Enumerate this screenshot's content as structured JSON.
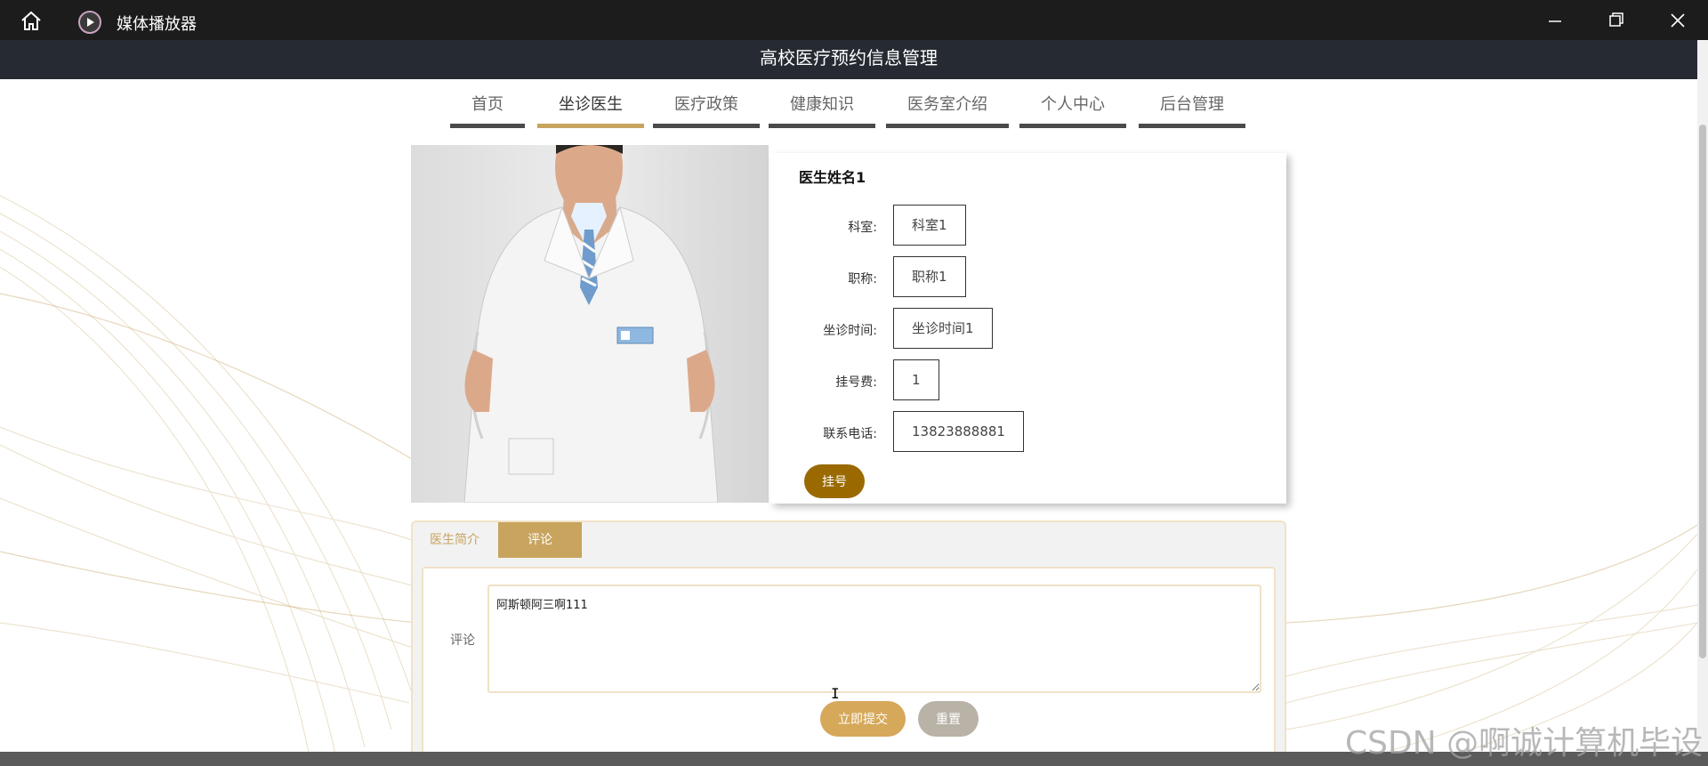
{
  "window": {
    "app_title": "媒体播放器",
    "controls": [
      "minimize",
      "maximize",
      "close"
    ]
  },
  "site": {
    "title": "高校医疗预约信息管理"
  },
  "nav": {
    "items": [
      {
        "label": "首页",
        "active": false
      },
      {
        "label": "坐诊医生",
        "active": true
      },
      {
        "label": "医疗政策",
        "active": false
      },
      {
        "label": "健康知识",
        "active": false
      },
      {
        "label": "医务室介绍",
        "active": false
      },
      {
        "label": "个人中心",
        "active": false
      },
      {
        "label": "后台管理",
        "active": false
      }
    ]
  },
  "doctor": {
    "name": "医生姓名1",
    "fields": [
      {
        "label": "科室:",
        "value": "科室1"
      },
      {
        "label": "职称:",
        "value": "职称1"
      },
      {
        "label": "坐诊时间:",
        "value": "坐诊时间1"
      },
      {
        "label": "挂号费:",
        "value": "1"
      },
      {
        "label": "联系电话:",
        "value": "13823888881"
      }
    ],
    "register_label": "挂号"
  },
  "tabs": {
    "items": [
      {
        "label": "医生简介",
        "active": false
      },
      {
        "label": "评论",
        "active": true
      }
    ]
  },
  "comment_form": {
    "label": "评论",
    "value": "阿斯顿阿三啊111",
    "submit_label": "立即提交",
    "reset_label": "重置"
  },
  "watermark": "CSDN @啊诚计算机毕设",
  "colors": {
    "accent_gold": "#c8a45e",
    "register_brown": "#9a6a00",
    "header_dark": "#262b33",
    "titlebar": "#1c1c1c"
  }
}
